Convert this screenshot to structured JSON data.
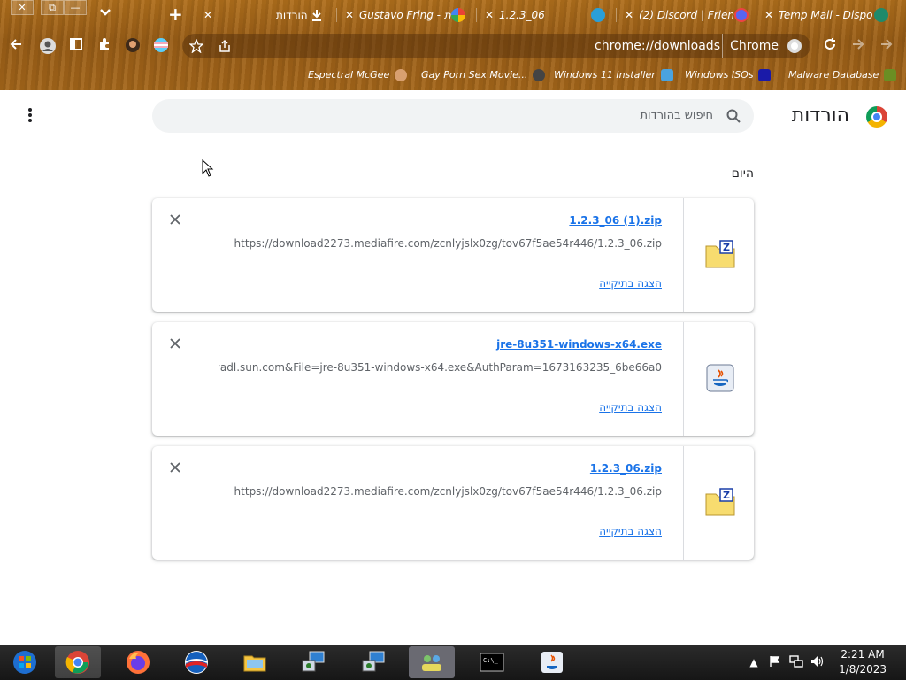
{
  "colors": {
    "accent_link": "#1a73e8",
    "text_primary": "#202124",
    "text_secondary": "#5f6368",
    "search_bg": "#f1f3f4",
    "taskbar_bg": "#1c1c1c",
    "theme_wood": "#a4661a"
  },
  "window_controls": {
    "close": "✕",
    "restore": "⧉",
    "minimize": "—"
  },
  "tab_controls": {
    "tab_search": "⌄",
    "new_tab": "+"
  },
  "tabs": [
    {
      "title": "הורדות",
      "close": "✕",
      "icon": "download-icon"
    },
    {
      "title": "Gustavo Fring - ת",
      "close": "✕",
      "icon": "google-image-favicon"
    },
    {
      "title": "1.2.3_06",
      "close": "✕",
      "icon": "telegram-favicon"
    },
    {
      "title": "(2) Discord | Frien",
      "close": "✕",
      "icon": "discord-favicon"
    },
    {
      "title": "Temp Mail - Dispo",
      "close": "✕",
      "icon": "tempmail-favicon"
    }
  ],
  "toolbar": {
    "url": "chrome://downloads",
    "brand": "Chrome"
  },
  "bookmarks": [
    {
      "label": "Espectral McGee",
      "icon": "avatar-favicon"
    },
    {
      "label": "Gay Porn Sex Movie...",
      "icon": "site-favicon"
    },
    {
      "label": "Windows 11 Installer",
      "icon": "windows-favicon"
    },
    {
      "label": "Windows ISOs",
      "icon": "x-favicon"
    },
    {
      "label": "Malware Database",
      "icon": "warning-favicon"
    }
  ],
  "page": {
    "title": "הורדות",
    "search_placeholder": "חיפוש בהורדות",
    "date_group": "היום"
  },
  "downloads": [
    {
      "file_name": "1.2.3_06 (1).zip",
      "url": "https://download2273.mediafire.com/zcnlyjslx0zg/tov67f5ae54r446/1.2.3_06.zip",
      "action": "הצגה בתיקייה",
      "file_type_icon": "zip-folder-icon"
    },
    {
      "file_name": "jre-8u351-windows-x64.exe",
      "url": "javadl.sun.com&File=jre-8u351-windows-x64.exe&AuthParam=1673163235_6be66a0...",
      "action": "הצגה בתיקייה",
      "file_type_icon": "java-installer-icon"
    },
    {
      "file_name": "1.2.3_06.zip",
      "url": "https://download2273.mediafire.com/zcnlyjslx0zg/tov67f5ae54r446/1.2.3_06.zip",
      "action": "הצגה בתיקייה",
      "file_type_icon": "zip-folder-icon"
    }
  ],
  "taskbar": {
    "apps": [
      "start-orb",
      "chrome",
      "firefox",
      "obama-app",
      "file-explorer",
      "remote-desktop-1",
      "remote-desktop-2",
      "network-app",
      "command-prompt",
      "java-console"
    ],
    "clock_time": "2:21 AM",
    "clock_date": "1/8/2023",
    "tray_chevron": "▲"
  }
}
